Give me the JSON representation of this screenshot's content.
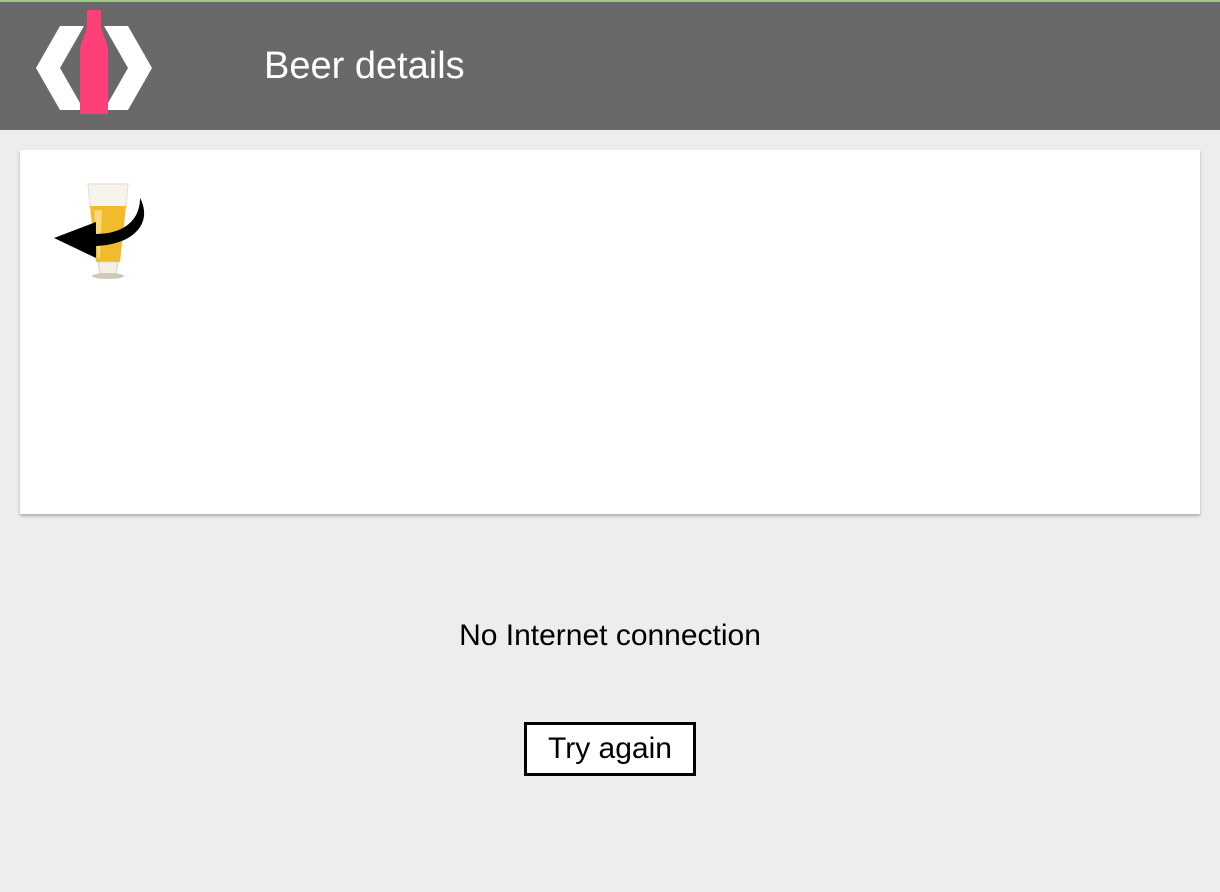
{
  "header": {
    "title": "Beer details",
    "logo_icon": "bottle-code-brackets-logo",
    "background_color": "#696969",
    "logo_accent_color": "#ff3f78"
  },
  "card": {
    "back_button_icon": "beer-glass-back-arrow-icon"
  },
  "error": {
    "message": "No Internet connection",
    "retry_label": "Try again"
  }
}
